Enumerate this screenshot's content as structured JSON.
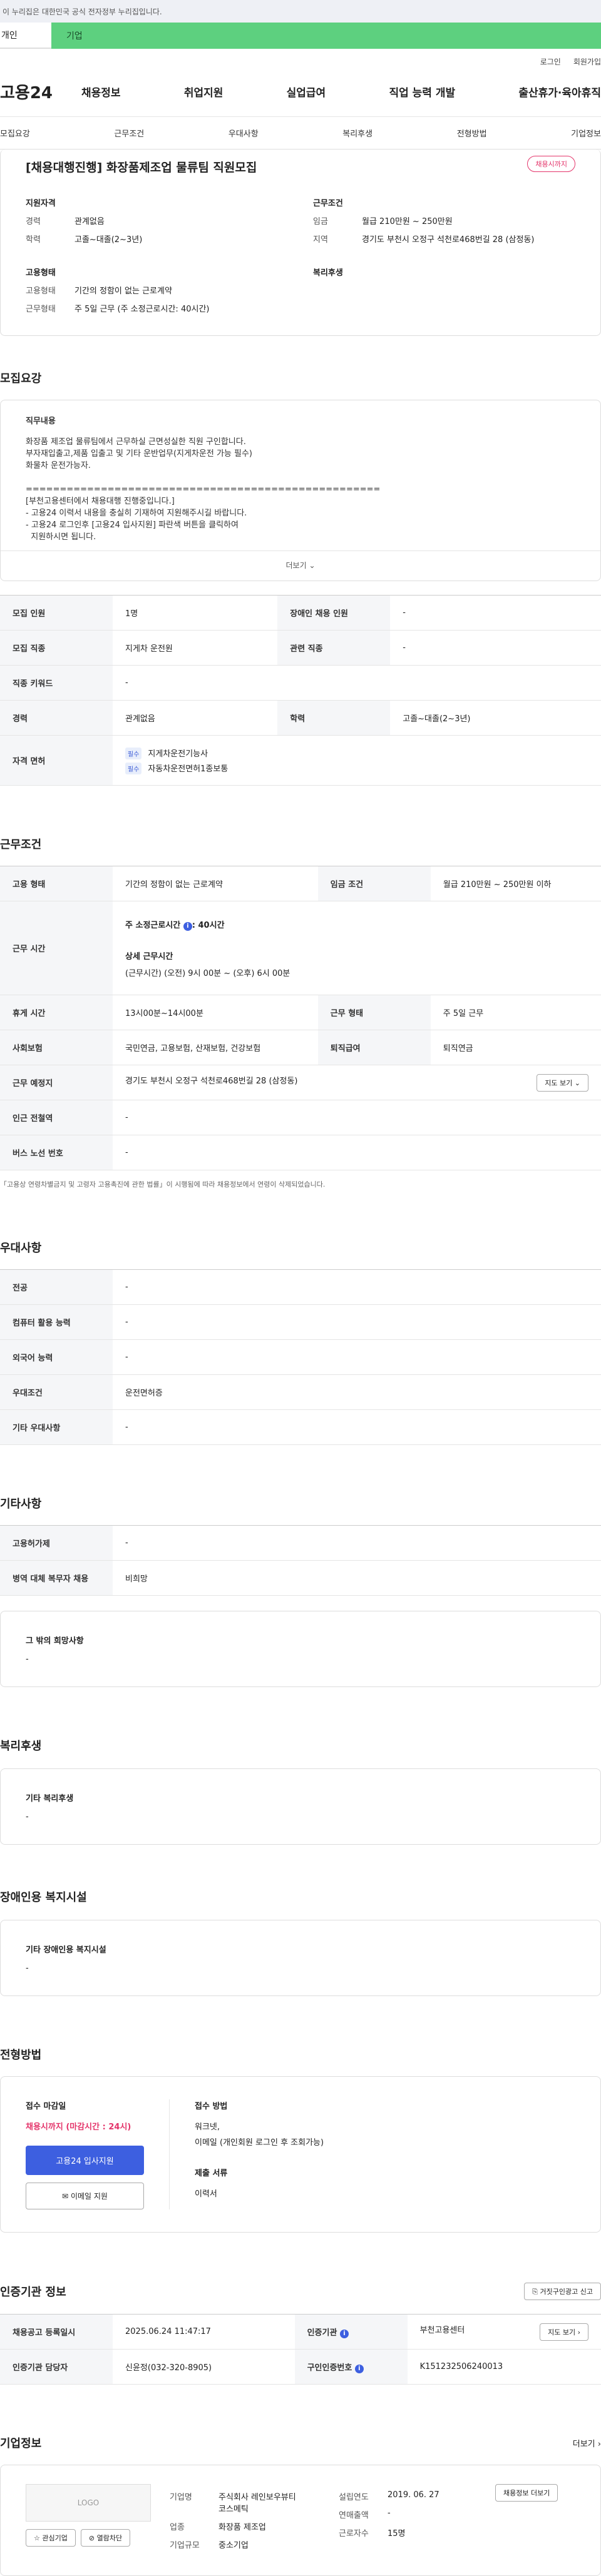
{
  "gov_banner": "이 누리집은 대한민국 공식 전자정부 누리집입니다.",
  "top_tabs": [
    "개인",
    "기업"
  ],
  "util": [
    "로그인",
    "회원가입"
  ],
  "logo": "고용24",
  "gnb": [
    "채용정보",
    "취업지원",
    "실업급여",
    "직업 능력 개발",
    "출산휴가·육아휴직"
  ],
  "snb": [
    "모집요강",
    "근무조건",
    "우대사항",
    "복리후생",
    "전형방법",
    "기업정보"
  ],
  "summary": {
    "title": "[채용대행진행] 화장품제조업 물류팀 직원모집",
    "badge": "채용시까지",
    "qual_h": "지원자격",
    "cond_h": "근무조건",
    "form_h": "고용형태",
    "welfare_h": "복리후생",
    "qual": [
      {
        "k": "경력",
        "v": "관계없음"
      },
      {
        "k": "학력",
        "v": "고졸~대졸(2~3년)"
      }
    ],
    "cond": [
      {
        "k": "임금",
        "v": "월급 210만원 ~ 250만원"
      },
      {
        "k": "지역",
        "v": "경기도 부천시 오정구 석천로468번길 28 (삼정동)"
      }
    ],
    "form": [
      {
        "k": "고용형태",
        "v": "기간의 정함이 없는 근로계약"
      },
      {
        "k": "근무형태",
        "v": "주 5일 근무 (주 소정근로시간: 40시간)"
      }
    ]
  },
  "recruit": {
    "h": "모집요강",
    "job_h": "직무내용",
    "lines": [
      "화장품 제조업 물류팀에서 근무하실 근면성실한 직원 구인합니다.",
      "부자재입출고,제품 입출고 및 기타 운반업무(지게차운전 가능 필수)",
      "화물차 운전가능자.",
      "",
      "====================================================",
      "[부천고용센터에서 채용대행 진행중입니다.]",
      "- 고용24 이력서 내용을 충실히 기재하여 지원해주시길 바랍니다.",
      "- 고용24 로그인후 [고용24 입사지원] 파란색 버튼을 클릭하여",
      "  지원하시면 됩니다."
    ],
    "more": "더보기",
    "rows": [
      [
        "모집 인원",
        "1명",
        "장애인 채용 인원",
        "-"
      ],
      [
        "모집 직종",
        "지게차 운전원",
        "관련 직종",
        "-"
      ],
      [
        "직종 키워드",
        "-",
        "",
        ""
      ],
      [
        "경력",
        "관계없음",
        "학력",
        "고졸~대졸(2~3년)"
      ]
    ],
    "license_k": "자격 면허",
    "req": "필수",
    "licenses": [
      "지게차운전기능사",
      "자동차운전면허1종보통"
    ]
  },
  "work": {
    "h": "근무조건",
    "r1": [
      "고용 형태",
      "기간의 정함이 없는 근로계약",
      "임금 조건",
      "월급 210만원 ~ 250만원 이하"
    ],
    "time_k": "근무 시간",
    "time_main": "주 소정근로시간",
    "time_val": "40시간",
    "time_sub": "상세 근무시간",
    "time_detail": "(근무시간) (오전) 9시 00분 ~ (오후) 6시 00분",
    "rows": [
      [
        "휴게 시간",
        "13시00분~14시00분",
        "근무 형태",
        "주 5일 근무"
      ],
      [
        "사회보험",
        "국민연금, 고용보험, 산재보험, 건강보험",
        "퇴직급여",
        "퇴직연금"
      ]
    ],
    "place_k": "근무 예정지",
    "place": "경기도 부천시 오정구 석천로468번길 28 (삼정동)",
    "map_btn": "지도 보기",
    "rows2": [
      [
        "인근 전철역",
        "-"
      ],
      [
        "버스 노선 번호",
        "-"
      ]
    ],
    "note": "「고용상 연령차별금지 및 고령자 고용촉진에 관한 법률」이 시행됨에 따라 채용정보에서 연령이 삭제되었습니다."
  },
  "pref": {
    "h": "우대사항",
    "rows": [
      [
        "전공",
        "-"
      ],
      [
        "컴퓨터 활용 능력",
        "-"
      ],
      [
        "외국어 능력",
        "-"
      ],
      [
        "우대조건",
        "운전면허증"
      ],
      [
        "기타 우대사항",
        "-"
      ]
    ]
  },
  "etc": {
    "h": "기타사항",
    "rows": [
      [
        "고용허가제",
        "-"
      ],
      [
        "병역 대체 복무자 채용",
        "비희망"
      ]
    ],
    "box_h": "그 밖의 희망사항",
    "box_v": "-"
  },
  "welfare": {
    "h": "복리후생",
    "box_h": "기타 복리후생",
    "box_v": "-"
  },
  "disab": {
    "h": "장애인용 복지시설",
    "box_h": "기타 장애인용 복지시설",
    "box_v": "-"
  },
  "process": {
    "h": "전형방법",
    "deadline_h": "접수 마감일",
    "deadline": "채용시까지 (마감시간 : 24시)",
    "apply_btn": "고용24 입사지원",
    "email_btn": "이메일 지원",
    "method_h": "접수 방법",
    "method": [
      "워크넷,",
      "이메일 (개인회원 로그인 후 조회가능)"
    ],
    "docs_h": "제출 서류",
    "docs": "이력서"
  },
  "cert": {
    "h": "인증기관 정보",
    "report": "거짓구인광고 신고",
    "r1": [
      "채용공고 등록일시",
      "2025.06.24 11:47:17",
      "인증기관",
      "부천고용센터"
    ],
    "view": "지도 보기",
    "r2": [
      "인증기관 담당자",
      "신윤정(032-320-8905)",
      "구인인증번호",
      "K151232506240013"
    ]
  },
  "company": {
    "h": "기업정보",
    "more": "더보기",
    "logo": "LOGO",
    "fav": "관심기업",
    "block": "열람차단",
    "info": [
      [
        "기업명",
        "주식회사 레인보우뷰티코스메틱"
      ],
      [
        "업종",
        "화장품 제조업"
      ],
      [
        "기업규모",
        "중소기업"
      ]
    ],
    "info2": [
      [
        "설립연도",
        "2019. 06. 27"
      ],
      [
        "연매출액",
        "-"
      ],
      [
        "근로자수",
        "15명"
      ]
    ],
    "jobs_btn": "채용정보 더보기"
  }
}
